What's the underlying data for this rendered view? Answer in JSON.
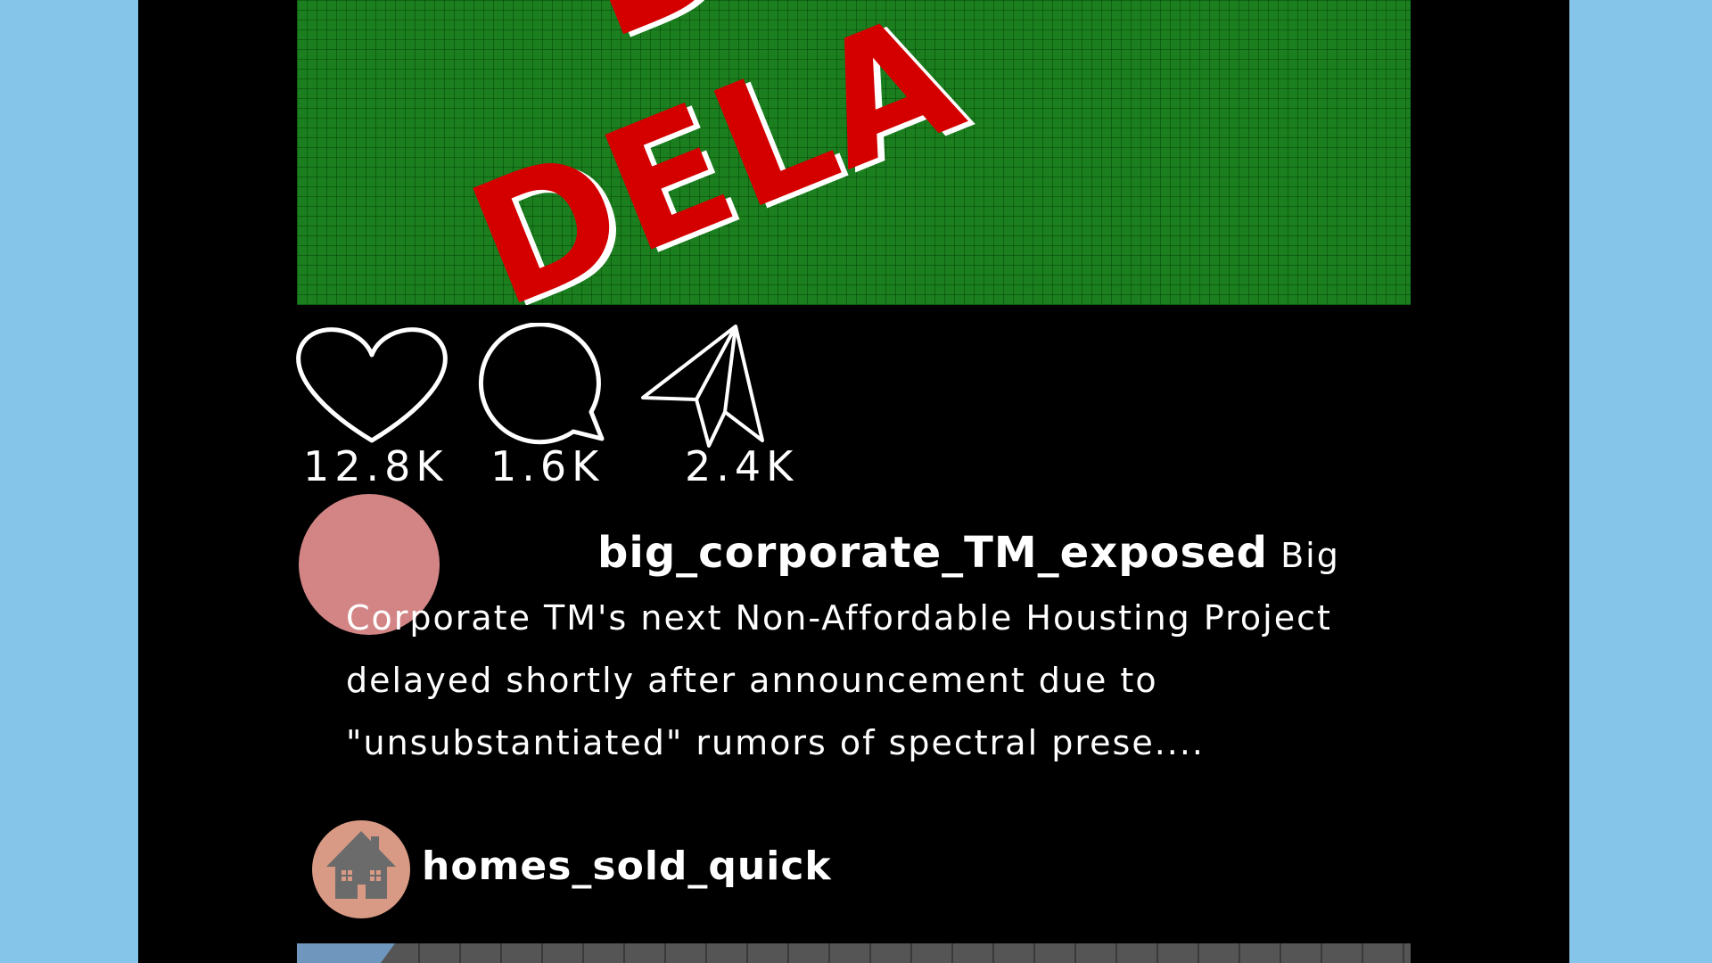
{
  "post": {
    "image_stamp_top": "D",
    "image_stamp": "DELA",
    "image_stamp_colors": {
      "text": "#d40000",
      "background": "#1b7f1f"
    }
  },
  "actions": {
    "likes": "12.8K",
    "comments": "1.6K",
    "shares": "2.4K",
    "icons": [
      "heart-icon",
      "comment-bubble-icon",
      "paper-plane-icon"
    ]
  },
  "caption": {
    "username": "big_corporate_TM_exposed",
    "text": "Big Corporate TM's next Non-Affordable Housting Project delayed shortly after announcement due to \"unsubstantiated\" rumors of spectral prese...."
  },
  "next_post": {
    "username": "homes_sold_quick",
    "avatar_icon": "house-icon"
  },
  "colors": {
    "page_bg": "#86c5ea",
    "feed_bg": "#000000",
    "author_avatar": "#d38585",
    "next_avatar": "#d99a85"
  }
}
